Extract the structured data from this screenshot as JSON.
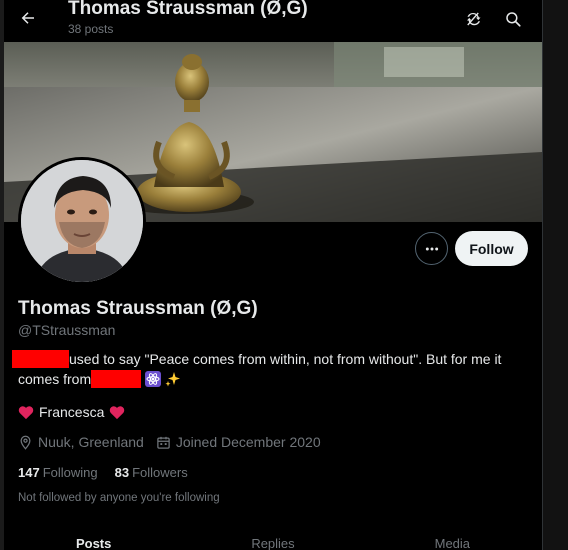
{
  "header": {
    "title": "Thomas Straussman (Ø,G)",
    "post_count": "38 posts"
  },
  "profile": {
    "display_name": "Thomas Straussman (Ø,G)",
    "handle": "@TStraussman",
    "bio_line1": "used to say \"Peace comes from within, not from without\". But for me it",
    "bio_line2": "comes from",
    "extra": "Francesca",
    "location": "Nuuk, Greenland",
    "joined": "Joined December 2020",
    "following_count": "147",
    "following_label": "Following",
    "followers_count": "83",
    "followers_label": "Followers",
    "not_followed_note": "Not followed by anyone you're following"
  },
  "actions": {
    "follow_label": "Follow"
  },
  "tabs": [
    {
      "label": "Posts"
    },
    {
      "label": "Replies"
    },
    {
      "label": "Media"
    }
  ],
  "icons": {
    "back": "arrow-left-icon",
    "sync": "sync-icon",
    "search": "search-icon",
    "more": "more-icon",
    "location": "location-pin-icon",
    "calendar": "calendar-icon",
    "heart": "heart-icon"
  },
  "colors": {
    "redaction": "#ff0000",
    "heart": "#f91880",
    "follow_bg": "#eff3f4"
  }
}
